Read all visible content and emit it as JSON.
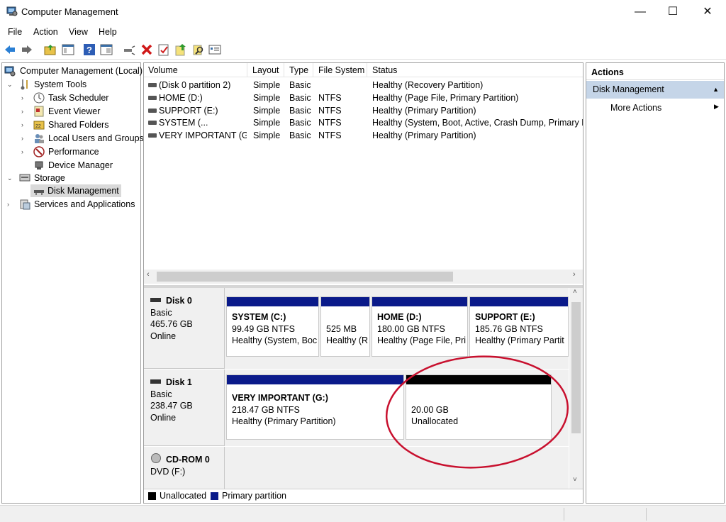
{
  "window": {
    "title": "Computer Management",
    "minimize_glyph": "—",
    "maximize_glyph": "☐",
    "close_glyph": "✕"
  },
  "menu": [
    "File",
    "Action",
    "View",
    "Help"
  ],
  "toolbar_icons": [
    "back-arrow-icon",
    "forward-arrow-icon",
    "up-folder-icon",
    "show-hide-console-tree-icon",
    "help-icon",
    "properties-icon",
    "connect-icon",
    "delete-icon",
    "check-icon",
    "export-icon",
    "search-icon",
    "console-icon"
  ],
  "tree": {
    "root": "Computer Management (Local)",
    "items": [
      {
        "label": "System Tools",
        "level": 1,
        "expanded": true
      },
      {
        "label": "Task Scheduler",
        "level": 2
      },
      {
        "label": "Event Viewer",
        "level": 2
      },
      {
        "label": "Shared Folders",
        "level": 2
      },
      {
        "label": "Local Users and Groups",
        "level": 2
      },
      {
        "label": "Performance",
        "level": 2
      },
      {
        "label": "Device Manager",
        "level": 2
      },
      {
        "label": "Storage",
        "level": 1,
        "expanded": true
      },
      {
        "label": "Disk Management",
        "level": 2,
        "selected": true
      },
      {
        "label": "Services and Applications",
        "level": 1
      }
    ]
  },
  "volume_list": {
    "columns": [
      "Volume",
      "Layout",
      "Type",
      "File System",
      "Status"
    ],
    "rows": [
      {
        "volume": "(Disk 0 partition 2)",
        "layout": "Simple",
        "type": "Basic",
        "fs": "",
        "status": "Healthy (Recovery Partition)"
      },
      {
        "volume": "HOME (D:)",
        "layout": "Simple",
        "type": "Basic",
        "fs": "NTFS",
        "status": "Healthy (Page File, Primary Partition)"
      },
      {
        "volume": "SUPPORT (E:)",
        "layout": "Simple",
        "type": "Basic",
        "fs": "NTFS",
        "status": "Healthy (Primary Partition)"
      },
      {
        "volume": "SYSTEM (...",
        "layout": "Simple",
        "type": "Basic",
        "fs": "NTFS",
        "status": "Healthy (System, Boot, Active, Crash Dump, Primary P..."
      },
      {
        "volume": "VERY IMPORTANT (G:)",
        "layout": "Simple",
        "type": "Basic",
        "fs": "NTFS",
        "status": "Healthy (Primary Partition)"
      }
    ]
  },
  "disks": [
    {
      "name": "Disk 0",
      "type": "Basic",
      "size": "465.76 GB",
      "state": "Online",
      "partitions": [
        {
          "name": "SYSTEM  (C:)",
          "size": "99.49 GB NTFS",
          "status": "Healthy (System, Boc"
        },
        {
          "name": "",
          "size": "525 MB",
          "status": "Healthy (R"
        },
        {
          "name": "HOME  (D:)",
          "size": "180.00 GB NTFS",
          "status": "Healthy (Page File, Pri"
        },
        {
          "name": "SUPPORT  (E:)",
          "size": "185.76 GB NTFS",
          "status": "Healthy (Primary Partit"
        }
      ]
    },
    {
      "name": "Disk 1",
      "type": "Basic",
      "size": "238.47 GB",
      "state": "Online",
      "partitions": [
        {
          "name": "VERY IMPORTANT  (G:)",
          "size": "218.47 GB NTFS",
          "status": "Healthy (Primary Partition)"
        },
        {
          "name": "",
          "size": "20.00 GB",
          "status": "Unallocated"
        }
      ]
    },
    {
      "name": "CD-ROM 0",
      "type": "DVD (F:)"
    }
  ],
  "legend": [
    {
      "label": "Unallocated",
      "color": "#000000"
    },
    {
      "label": "Primary partition",
      "color": "#0a1a8a"
    }
  ],
  "actions": {
    "header": "Actions",
    "section": "Disk Management",
    "more": "More Actions"
  },
  "colors": {
    "primary_bar": "#0a1a8a",
    "unallocated_bar": "#000000",
    "selection": "#c5d5e8",
    "annotation": "#c8102e"
  }
}
